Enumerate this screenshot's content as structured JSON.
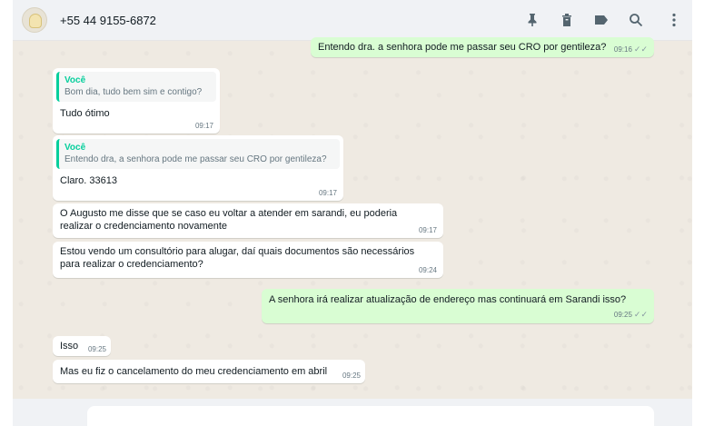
{
  "header": {
    "contact_name": "+55 44 9155-6872",
    "icons": [
      "pin-icon",
      "trash-icon",
      "label-icon",
      "search-icon",
      "menu-icon"
    ]
  },
  "messages": [
    {
      "dir": "out",
      "text": "Entendo dra. a senhora pode me passar seu CRO por gentileza?",
      "time": "09:16",
      "status": "read"
    },
    {
      "dir": "in",
      "quote_author": "Você",
      "quote_text": "Bom dia, tudo bem sim e contigo?",
      "text": "Tudo ótimo",
      "time": "09:17"
    },
    {
      "dir": "in",
      "quote_author": "Você",
      "quote_text": "Entendo dra, a senhora pode me passar seu CRO por gentileza?",
      "text": "Claro. 33613",
      "time": "09:17"
    },
    {
      "dir": "in",
      "text": "O Augusto me disse que se caso eu voltar a atender em sarandi, eu poderia realizar o credenciamento novamente",
      "time": "09:17"
    },
    {
      "dir": "in",
      "text": "Estou vendo um consultório para alugar, daí quais documentos são necessários para realizar o credenciamento?",
      "time": "09:24"
    },
    {
      "dir": "out",
      "text": "A senhora irá realizar atualização de endereço mas continuará em Sarandi isso?",
      "time": "09:25",
      "status": "read"
    },
    {
      "dir": "in",
      "text": "Isso",
      "time": "09:25"
    },
    {
      "dir": "in",
      "text": "Mas eu fiz o cancelamento do meu credenciamento em abril",
      "time": "09:25"
    }
  ],
  "colors": {
    "incoming": "#ffffff",
    "outgoing": "#d9fdd3",
    "quote_accent": "#06cf9c",
    "background": "#efeae2"
  }
}
